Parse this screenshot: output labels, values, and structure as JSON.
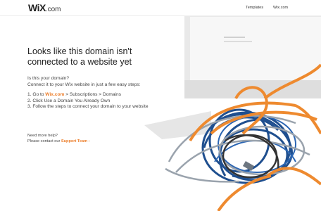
{
  "header": {
    "logo_mark": "WiX",
    "logo_suffix": ".com",
    "nav": [
      "Templates",
      "Wix.com"
    ]
  },
  "main": {
    "headline_line1": "Looks like this domain isn't",
    "headline_line2": "connected to a website yet",
    "question": "Is this your domain?",
    "intro": "Connect it to your Wix website in just a few easy steps:",
    "step1_prefix": "1. Go to ",
    "step1_link": "Wix.com",
    "step1_suffix": " > Subscriptions > Domains",
    "step2": "2. Click Use a Domain You Already Own",
    "step3": "3. Follow the steps to connect your domain to your website"
  },
  "help": {
    "need_help": "Need more help?",
    "contact_prefix": "Please contact our ",
    "support_link": "Support Team",
    "support_arrow": "›"
  },
  "colors": {
    "accent": "#ec7e2b",
    "text": "#333333"
  }
}
